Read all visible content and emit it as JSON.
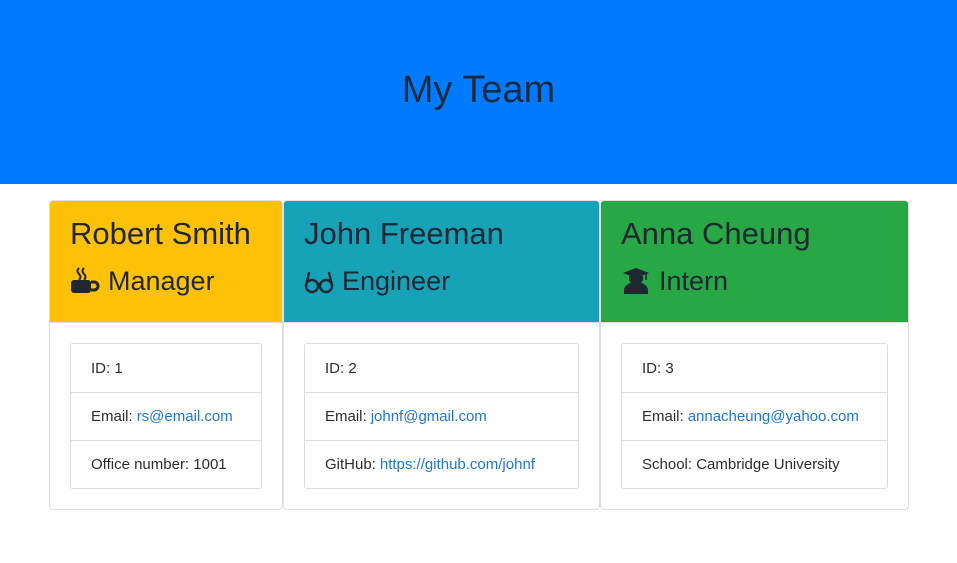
{
  "header": {
    "title": "My Team"
  },
  "colors": {
    "header_bg": "#007bff",
    "manager": "#ffc107",
    "engineer": "#17a2b8",
    "intern": "#28a745",
    "link": "#1f76d0"
  },
  "cards": [
    {
      "name": "Robert Smith",
      "role": "Manager",
      "icon": "coffee-mug-icon",
      "id_text": "ID: 1",
      "email_label": "Email:",
      "email": "rs@email.com",
      "extra_label": "Office number: 1001"
    },
    {
      "name": "John Freeman",
      "role": "Engineer",
      "icon": "glasses-icon",
      "id_text": "ID: 2",
      "email_label": "Email:",
      "email": "johnf@gmail.com",
      "extra_label": "GitHub:",
      "extra_link": "https://github.com/johnf"
    },
    {
      "name": "Anna Cheung",
      "role": "Intern",
      "icon": "graduate-icon",
      "id_text": "ID: 3",
      "email_label": "Email:",
      "email": "annacheung@yahoo.com",
      "extra_label": "School: Cambridge University"
    }
  ]
}
